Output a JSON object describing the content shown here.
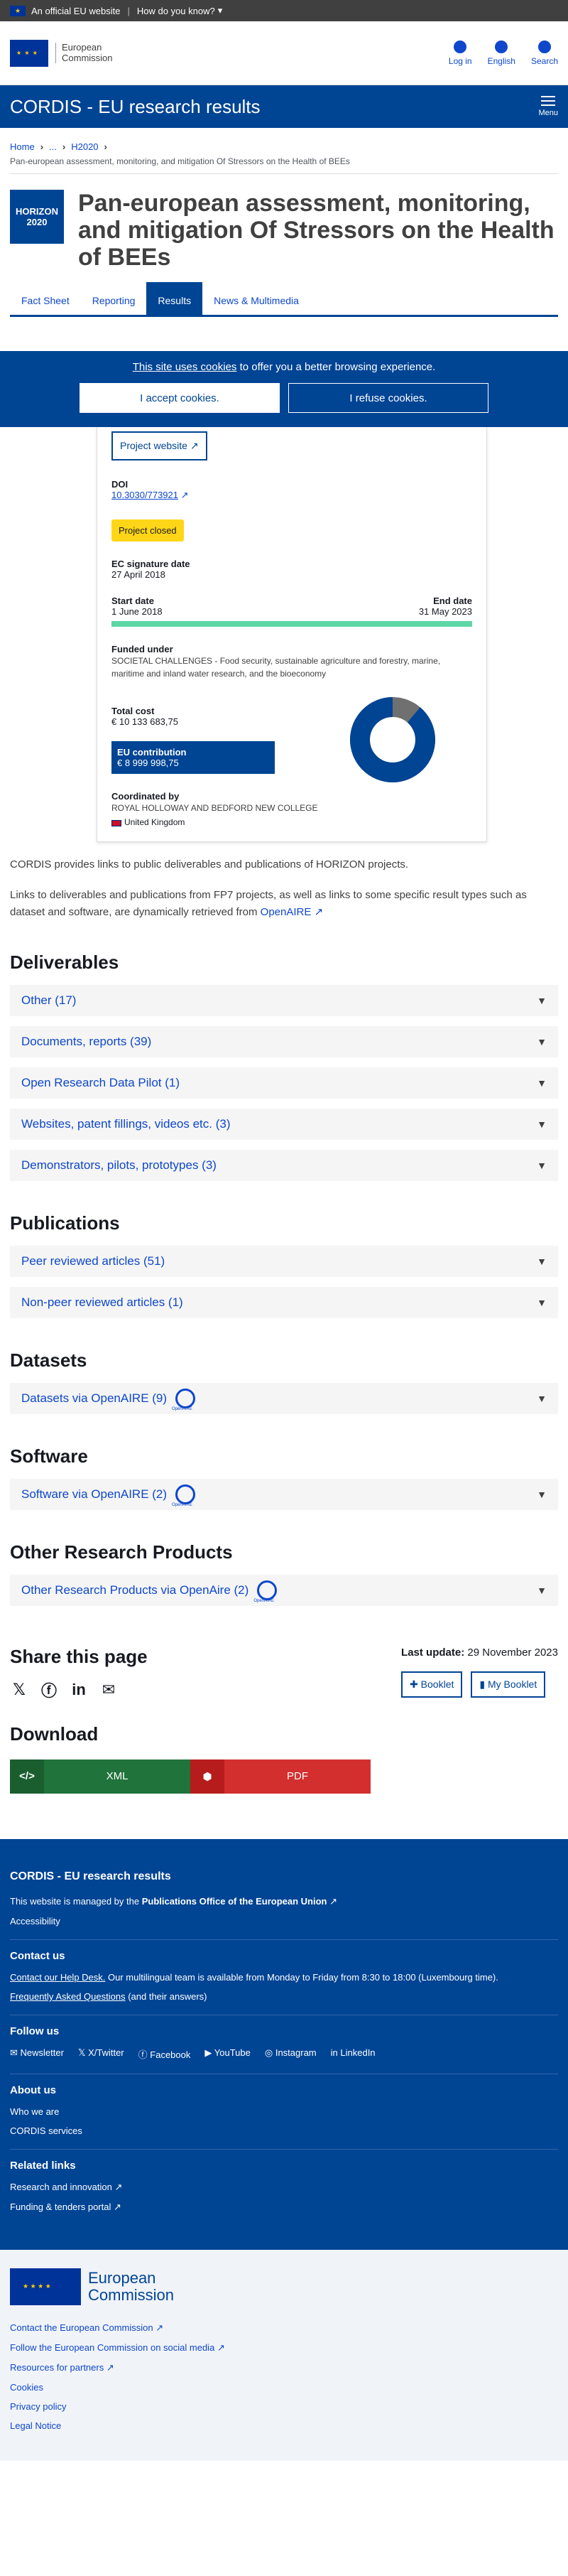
{
  "topbar": {
    "official": "An official EU website",
    "how": "How do you know?"
  },
  "header": {
    "logo_line1": "European",
    "logo_line2": "Commission",
    "login": "Log in",
    "language": "English",
    "search": "Search"
  },
  "cordis": {
    "title": "CORDIS - EU research results",
    "menu": "Menu"
  },
  "breadcrumb": {
    "home": "Home",
    "ellipsis": "...",
    "h2020": "H2020"
  },
  "project": {
    "subtitle": "Pan-european assessment, monitoring, and mitigation Of Stressors on the Health of BEEs",
    "badge_line1": "HORIZON",
    "badge_line2": "2020",
    "title": "Pan-european assessment, monitoring, and mitigation Of Stressors on the Health of BEEs"
  },
  "tabs": [
    "Fact Sheet",
    "Reporting",
    "Results",
    "News & Multimedia"
  ],
  "cookie": {
    "link": "This site uses cookies",
    "rest": " to offer you a better browsing experience.",
    "accept": "I accept cookies.",
    "refuse": "I refuse cookies."
  },
  "card": {
    "website": "Project website",
    "doi_label": "DOI",
    "doi_value": "10.3030/773921",
    "status": "Project closed",
    "signature_label": "EC signature date",
    "signature_value": "27 April 2018",
    "start_label": "Start date",
    "start_value": "1 June 2018",
    "end_label": "End date",
    "end_value": "31 May 2023",
    "funded_label": "Funded under",
    "funded_value": "SOCIETAL CHALLENGES - Food security, sustainable agriculture and forestry, marine, maritime and inland water research, and the bioeconomy",
    "total_label": "Total cost",
    "total_value": "€ 10 133 683,75",
    "eu_label": "EU contribution",
    "eu_value": "€ 8 999 998,75",
    "coord_label": "Coordinated by",
    "coord_value": "ROYAL HOLLOWAY AND BEDFORD NEW COLLEGE",
    "country": "United Kingdom",
    "eu_share": 0.888,
    "colors": {
      "eu": "#004494",
      "rest": "#707070"
    }
  },
  "intro": {
    "p1": "CORDIS provides links to public deliverables and publications of HORIZON projects.",
    "p2": "Links to deliverables and publications from FP7 projects, as well as links to some specific result types such as dataset and software, are dynamically retrieved from",
    "openaire": "OpenAIRE"
  },
  "sections": {
    "deliverables": "Deliverables",
    "publications": "Publications",
    "datasets": "Datasets",
    "software": "Software",
    "other": "Other Research Products"
  },
  "deliverables": [
    "Other (17)",
    "Documents, reports (39)",
    "Open Research Data Pilot (1)",
    "Websites, patent fillings, videos etc. (3)",
    "Demonstrators, pilots, prototypes (3)"
  ],
  "publications": [
    "Peer reviewed articles (51)",
    "Non-peer reviewed articles (1)"
  ],
  "datasets": [
    "Datasets via OpenAIRE (9)"
  ],
  "software": [
    "Software via OpenAIRE (2)"
  ],
  "other_products": [
    "Other Research Products via OpenAire (2)"
  ],
  "share": {
    "title": "Share this page",
    "last_update_label": "Last update:",
    "last_update_value": "29 November 2023",
    "booklet": "Booklet",
    "my_booklet": "My Booklet"
  },
  "download": {
    "title": "Download",
    "xml": "XML",
    "pdf": "PDF"
  },
  "footer": {
    "title": "CORDIS - EU research results",
    "managed_pre": "This website is managed by the",
    "managed_link": "Publications Office of the European Union",
    "accessibility": "Accessibility",
    "contact_title": "Contact us",
    "helpdesk_link": "Contact our Help Desk.",
    "helpdesk_text": " Our multilingual team is available from Monday to Friday from 8:30 to 18:00 (Luxembourg time).",
    "faq_link": "Frequently Asked Questions",
    "faq_text": " (and their answers)",
    "follow_title": "Follow us",
    "social": [
      "Newsletter",
      "X/Twitter",
      "Facebook",
      "YouTube",
      "Instagram",
      "LinkedIn"
    ],
    "about_title": "About us",
    "about": [
      "Who we are",
      "CORDIS services"
    ],
    "related_title": "Related links",
    "related": [
      "Research and innovation",
      "Funding & tenders portal"
    ],
    "ec_line1": "European",
    "ec_line2": "Commission",
    "ec_links": [
      "Contact the European Commission",
      "Follow the European Commission on social media",
      "Resources for partners",
      "Cookies",
      "Privacy policy",
      "Legal Notice"
    ]
  }
}
